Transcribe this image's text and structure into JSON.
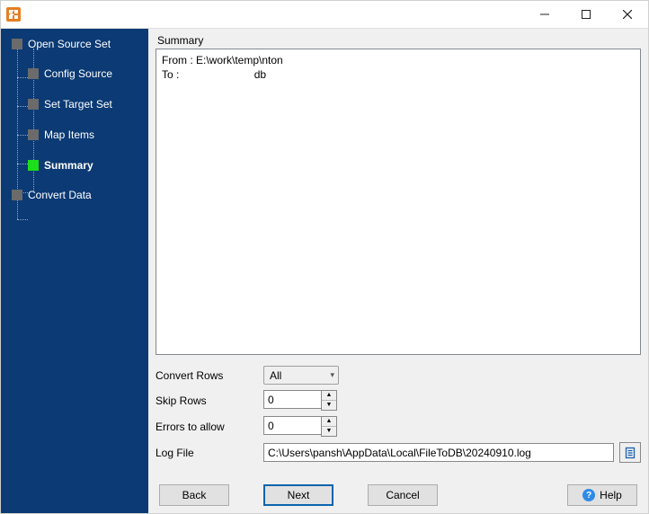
{
  "window": {
    "minimize_title": "Minimize",
    "maximize_title": "Maximize",
    "close_title": "Close"
  },
  "sidebar": {
    "items": [
      {
        "label": "Open Source Set"
      },
      {
        "label": "Config Source"
      },
      {
        "label": "Set Target Set"
      },
      {
        "label": "Map Items"
      },
      {
        "label": "Summary"
      },
      {
        "label": "Convert Data"
      }
    ]
  },
  "content": {
    "summary_label": "Summary",
    "summary_text": "From : E:\\work\\temp\\nton\nTo :                         db"
  },
  "form": {
    "convert_rows_label": "Convert Rows",
    "convert_rows_value": "All",
    "skip_rows_label": "Skip Rows",
    "skip_rows_value": "0",
    "errors_label": "Errors to allow",
    "errors_value": "0",
    "logfile_label": "Log File",
    "logfile_value": "C:\\Users\\pansh\\AppData\\Local\\FileToDB\\20240910.log"
  },
  "buttons": {
    "back": "Back",
    "next": "Next",
    "cancel": "Cancel",
    "help": "Help"
  }
}
